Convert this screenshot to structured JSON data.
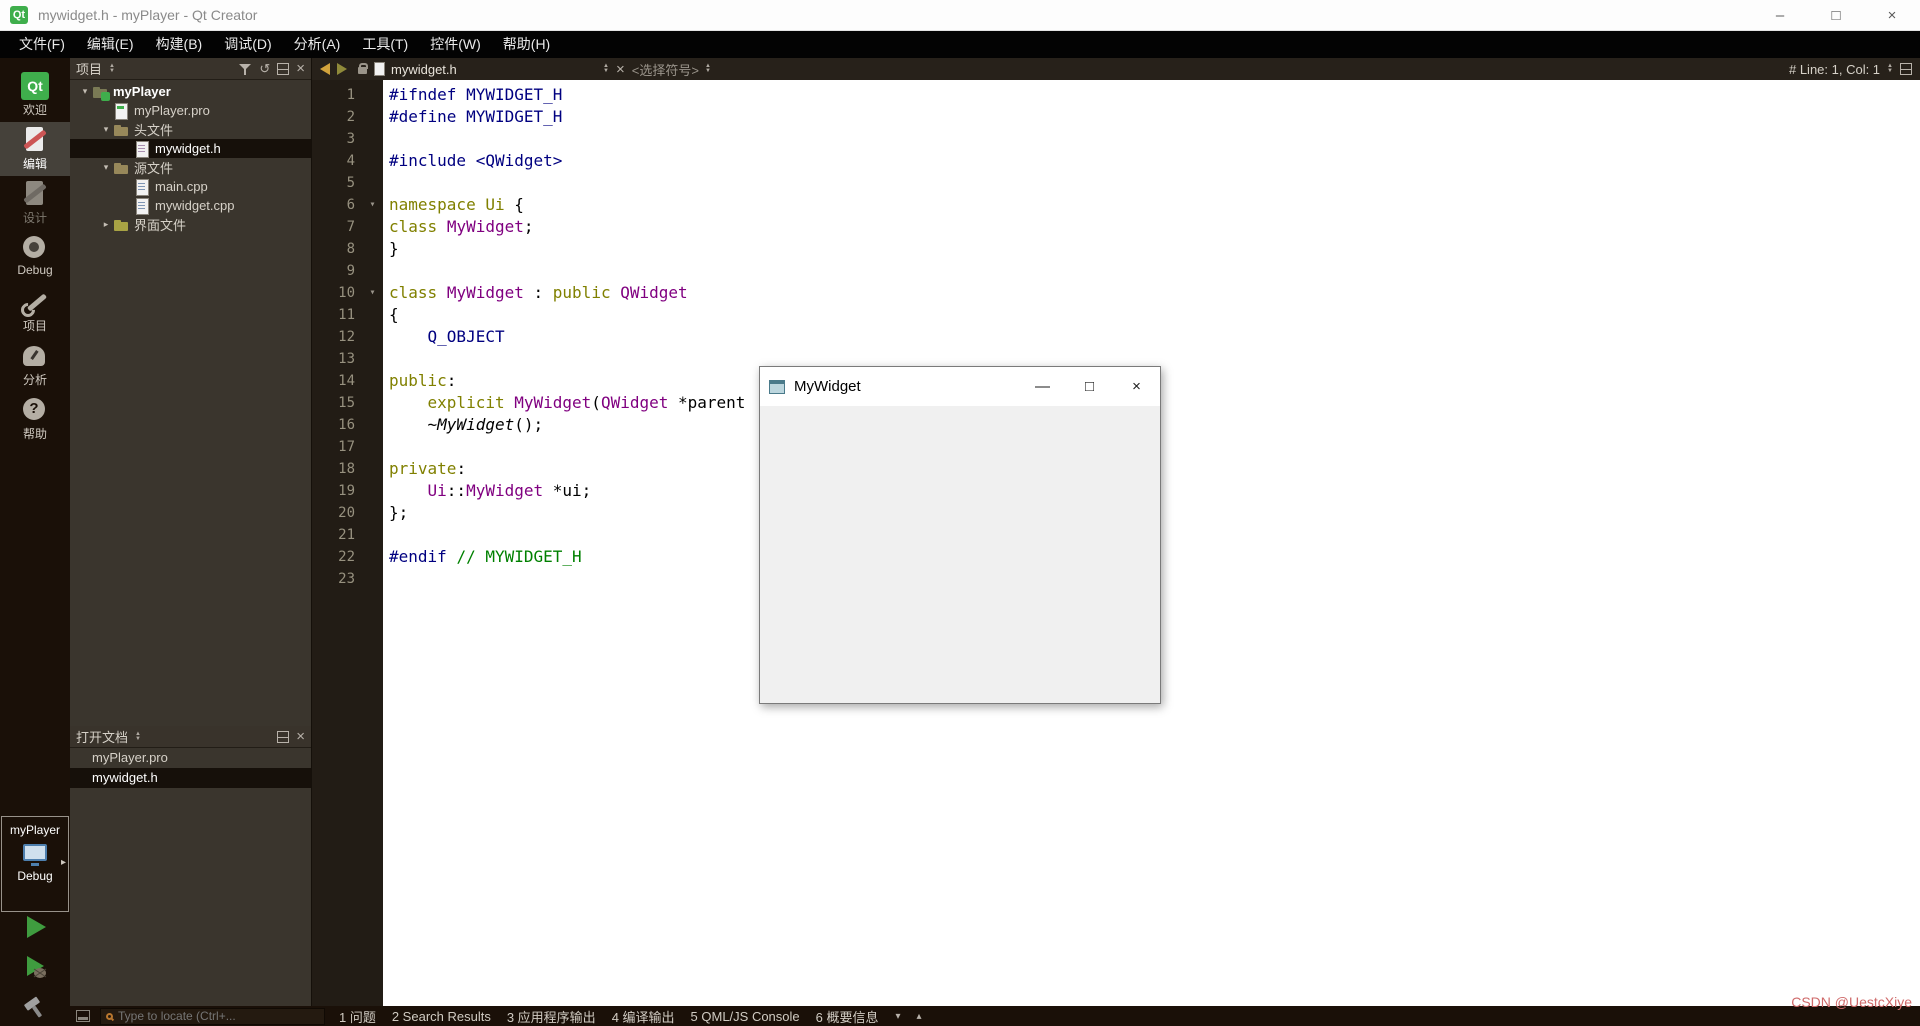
{
  "window": {
    "logo_text": "Qt",
    "title": "mywidget.h - myPlayer - Qt Creator",
    "controls": {
      "minimize": "–",
      "maximize": "□",
      "close": "×"
    }
  },
  "menu": {
    "items": [
      "文件(F)",
      "编辑(E)",
      "构建(B)",
      "调试(D)",
      "分析(A)",
      "工具(T)",
      "控件(W)",
      "帮助(H)"
    ]
  },
  "modes": {
    "items": [
      {
        "id": "welcome",
        "label": "欢迎",
        "icon": "qt-welcome-icon",
        "icon_text": "Qt",
        "active": false,
        "disabled": false
      },
      {
        "id": "edit",
        "label": "编辑",
        "icon": "edit-mode-icon",
        "active": true,
        "disabled": false
      },
      {
        "id": "design",
        "label": "设计",
        "icon": "design-mode-icon",
        "active": false,
        "disabled": true
      },
      {
        "id": "debug",
        "label": "Debug",
        "icon": "debug-mode-icon",
        "active": false,
        "disabled": false
      },
      {
        "id": "projects",
        "label": "项目",
        "icon": "projects-mode-icon",
        "active": false,
        "disabled": false
      },
      {
        "id": "analyze",
        "label": "分析",
        "icon": "analyze-mode-icon",
        "active": false,
        "disabled": false
      },
      {
        "id": "help",
        "label": "帮助",
        "icon": "help-mode-icon",
        "active": false,
        "disabled": false
      }
    ],
    "kit": {
      "project": "myPlayer",
      "config": "Debug"
    }
  },
  "project_panel": {
    "title": "项目",
    "tree": [
      {
        "label": "myPlayer",
        "level": 0,
        "icon": "project-folder-icon",
        "badge": "qt",
        "arrow": "expanded",
        "bold": true,
        "selected": false
      },
      {
        "label": "myPlayer.pro",
        "level": 1,
        "icon": "pro-file-icon",
        "arrow": "none",
        "bold": false,
        "selected": false
      },
      {
        "label": "头文件",
        "level": 1,
        "icon": "folder-icon",
        "arrow": "expanded",
        "bold": false,
        "selected": false
      },
      {
        "label": "mywidget.h",
        "level": 2,
        "icon": "header-file-icon",
        "arrow": "none",
        "bold": false,
        "selected": true
      },
      {
        "label": "源文件",
        "level": 1,
        "icon": "folder-icon",
        "arrow": "expanded",
        "bold": false,
        "selected": false
      },
      {
        "label": "main.cpp",
        "level": 2,
        "icon": "cpp-file-icon",
        "arrow": "none",
        "bold": false,
        "selected": false
      },
      {
        "label": "mywidget.cpp",
        "level": 2,
        "icon": "cpp-file-icon",
        "arrow": "none",
        "bold": false,
        "selected": false
      },
      {
        "label": "界面文件",
        "level": 1,
        "icon": "form-folder-icon",
        "arrow": "collapsed",
        "bold": false,
        "selected": false
      }
    ]
  },
  "open_docs": {
    "title": "打开文档",
    "items": [
      {
        "label": "myPlayer.pro",
        "selected": false
      },
      {
        "label": "mywidget.h",
        "selected": true
      }
    ]
  },
  "editor": {
    "filename": "mywidget.h",
    "symbol_combo": "<选择符号>",
    "cursor_indicator": "# Line: 1, Col: 1"
  },
  "code": {
    "colors": {
      "pre": "#000080",
      "kw": "#808000",
      "type": "#800080",
      "com": "#008000",
      "plain": "#000000"
    },
    "lines": [
      {
        "seg": [
          {
            "t": "#ifndef MYWIDGET_H",
            "c": "pre"
          }
        ]
      },
      {
        "seg": [
          {
            "t": "#define MYWIDGET_H",
            "c": "pre"
          }
        ]
      },
      {
        "seg": []
      },
      {
        "seg": [
          {
            "t": "#include <QWidget>",
            "c": "pre"
          }
        ]
      },
      {
        "seg": []
      },
      {
        "fold": true,
        "seg": [
          {
            "t": "namespace",
            "c": "kw"
          },
          {
            "t": " ",
            "c": "plain"
          },
          {
            "t": "Ui",
            "c": "kw"
          },
          {
            "t": " {",
            "c": "plain"
          }
        ]
      },
      {
        "seg": [
          {
            "t": "class",
            "c": "kw"
          },
          {
            "t": " ",
            "c": "plain"
          },
          {
            "t": "MyWidget",
            "c": "type"
          },
          {
            "t": ";",
            "c": "plain"
          }
        ]
      },
      {
        "seg": [
          {
            "t": "}",
            "c": "plain"
          }
        ]
      },
      {
        "seg": []
      },
      {
        "fold": true,
        "seg": [
          {
            "t": "class",
            "c": "kw"
          },
          {
            "t": " ",
            "c": "plain"
          },
          {
            "t": "MyWidget",
            "c": "type"
          },
          {
            "t": " : ",
            "c": "plain"
          },
          {
            "t": "public",
            "c": "kw"
          },
          {
            "t": " ",
            "c": "plain"
          },
          {
            "t": "QWidget",
            "c": "type"
          }
        ]
      },
      {
        "seg": [
          {
            "t": "{",
            "c": "plain"
          }
        ]
      },
      {
        "seg": [
          {
            "t": "    ",
            "c": "plain"
          },
          {
            "t": "Q_OBJECT",
            "c": "pre"
          }
        ]
      },
      {
        "seg": []
      },
      {
        "seg": [
          {
            "t": "public",
            "c": "kw"
          },
          {
            "t": ":",
            "c": "plain"
          }
        ]
      },
      {
        "seg": [
          {
            "t": "    ",
            "c": "plain"
          },
          {
            "t": "explicit",
            "c": "kw"
          },
          {
            "t": " ",
            "c": "plain"
          },
          {
            "t": "MyWidget",
            "c": "type"
          },
          {
            "t": "(",
            "c": "plain"
          },
          {
            "t": "QWidget",
            "c": "type"
          },
          {
            "t": " *parent",
            "c": "plain"
          }
        ]
      },
      {
        "seg": [
          {
            "t": "    ",
            "c": "plain"
          },
          {
            "t": "~MyWidget",
            "c": "plain",
            "i": true
          },
          {
            "t": "();",
            "c": "plain"
          }
        ]
      },
      {
        "seg": []
      },
      {
        "seg": [
          {
            "t": "private",
            "c": "kw"
          },
          {
            "t": ":",
            "c": "plain"
          }
        ]
      },
      {
        "seg": [
          {
            "t": "    ",
            "c": "plain"
          },
          {
            "t": "Ui",
            "c": "type"
          },
          {
            "t": "::",
            "c": "plain"
          },
          {
            "t": "MyWidget",
            "c": "type"
          },
          {
            "t": " *ui;",
            "c": "plain"
          }
        ]
      },
      {
        "seg": [
          {
            "t": "};",
            "c": "plain"
          }
        ]
      },
      {
        "seg": []
      },
      {
        "seg": [
          {
            "t": "#endif",
            "c": "pre"
          },
          {
            "t": " ",
            "c": "plain"
          },
          {
            "t": "// MYWIDGET_H",
            "c": "com"
          }
        ]
      },
      {
        "seg": []
      }
    ]
  },
  "app_window": {
    "title": "MyWidget",
    "controls": {
      "minimize": "—",
      "maximize": "□",
      "close": "×"
    }
  },
  "status": {
    "locator_placeholder": "Type to locate (Ctrl+...",
    "panes": [
      {
        "label": "1 问题"
      },
      {
        "label": "2 Search Results"
      },
      {
        "label": "3 应用程序输出"
      },
      {
        "label": "4 编译输出"
      },
      {
        "label": "5 QML/JS Console"
      },
      {
        "label": "6 概要信息"
      }
    ]
  },
  "watermark": "CSDN @UestcXiye"
}
